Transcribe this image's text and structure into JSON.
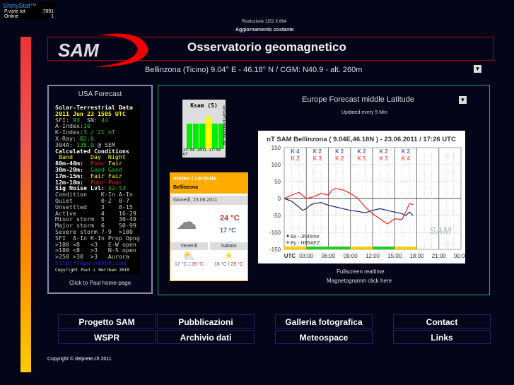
{
  "counter": {
    "brand": "ShinyStat™",
    "rows": [
      {
        "label": "P.viste tot",
        "value": "7891"
      },
      {
        "label": "Online",
        "value": "1"
      }
    ]
  },
  "header": {
    "resolution": "Risoluzione 1152 X 864",
    "update": "Aggiornamento costante",
    "logo": "SAM",
    "title": "Osservatorio geomagnetico",
    "location": "Bellinzona (Ticino) 9.04° E - 46.18° N / CGM: N40.9 - alt. 260m"
  },
  "usa": {
    "title": "USA Forecast",
    "link": "Click to Paul home-page",
    "solar": {
      "head": "Solar-Terrestrial Data",
      "date": "2011 Jun 23 1505 UTC",
      "sfi": "93",
      "sn": "44",
      "aindex": "10",
      "kindex": "3 / 21 nT",
      "xray": "B2.6",
      "a304": "135.0",
      "url": "http://www.n0nbh.com",
      "copy": "Copyright Paul L Herrman 2010"
    }
  },
  "europe": {
    "title": "Europe Forecast middle Latitude",
    "updated": "Updated every 5 Min",
    "link1": "Fullscreen realtime",
    "link2": "Magnetogramm click here"
  },
  "ksam": {
    "title": "Ksam (5)",
    "stamp": "23.06.2011 17:30 UT",
    "side": "solarlichtinfo.de",
    "values": [
      4,
      4,
      4,
      5,
      4,
      4
    ]
  },
  "meteo": {
    "brand": "meteo | centrale",
    "city": "Bellinzona",
    "date": "Giovedì, 23.06.2011",
    "tmax": "24 °C",
    "tmin": "17 °C",
    "days": [
      {
        "name": "Venerdì",
        "lo": "17 °C",
        "hi": "28 °C"
      },
      {
        "name": "Sabato",
        "lo": "18 °C",
        "hi": "29 °C"
      }
    ]
  },
  "chart_data": {
    "type": "line",
    "title": "nT SAM Bellinzona ( 9.04E,46.18N ) - 23.06.2011 / 17:26 UTC",
    "ylim": [
      -150,
      150
    ],
    "yticks": [
      150,
      100,
      50,
      0,
      -50,
      -100,
      -150
    ],
    "xticks": [
      "UTC",
      "03:00",
      "06:00",
      "09:00",
      "12:00",
      "15:00",
      "18:00",
      "21:00",
      "00:00"
    ],
    "grid": true,
    "legend": "bottom-left",
    "k_blue": [
      "K 4",
      "K 2",
      "K 2",
      "K 2",
      "K 2",
      "K 2"
    ],
    "k_red": [
      "K 2",
      "K 3",
      "K 2",
      "K 5",
      "K 3",
      "K 4"
    ],
    "series": [
      {
        "name": "Bx - JN46me",
        "color": "#1a237e",
        "x": [
          0,
          1,
          2,
          2.5,
          3,
          3.5,
          4,
          5,
          6,
          7,
          8,
          9,
          10,
          11,
          12,
          13,
          14,
          15,
          16,
          16.5,
          17,
          17.5
        ],
        "y": [
          0,
          -8,
          -25,
          -35,
          -30,
          -20,
          -15,
          -12,
          -20,
          -25,
          -30,
          -35,
          -38,
          -42,
          -35,
          -30,
          -35,
          -40,
          -45,
          -50,
          -40,
          -50
        ]
      },
      {
        "name": "By - HB9AFZ",
        "color": "#ff2020",
        "x": [
          0,
          1,
          2,
          3,
          4,
          5,
          6,
          6.5,
          7,
          8,
          9,
          10,
          11,
          12,
          13,
          14,
          15,
          16,
          16.5,
          17,
          17.5
        ],
        "y": [
          0,
          10,
          18,
          0,
          5,
          15,
          10,
          25,
          30,
          25,
          15,
          0,
          -25,
          -45,
          -60,
          -75,
          -60,
          -62,
          -40,
          -15,
          -18
        ]
      }
    ],
    "activity_bar": [
      "#fc0",
      "#2c2",
      "#2c2",
      "#fc0",
      "#2c2",
      "#fc0"
    ]
  },
  "nav": [
    [
      "Progetto SAM",
      "WSPR"
    ],
    [
      "Pubblicazioni",
      "Archivio dati"
    ],
    [
      "Galleria fotografica",
      "Meteospace"
    ],
    [
      "Contact",
      "Links"
    ]
  ],
  "footer": "Copyright © delprete.ch 2011"
}
